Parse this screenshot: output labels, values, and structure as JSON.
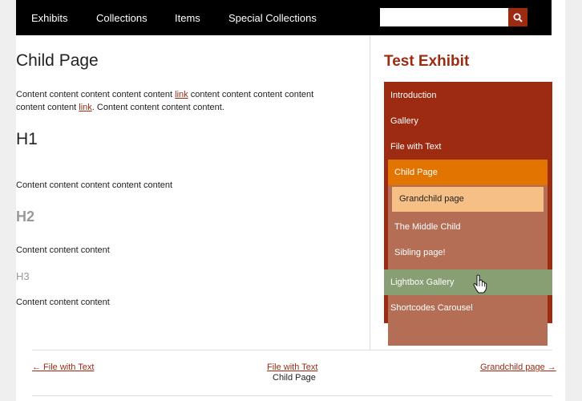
{
  "nav": {
    "items": [
      "Exhibits",
      "Collections",
      "Items",
      "Special Collections"
    ],
    "search_placeholder": ""
  },
  "main": {
    "title": "Child Page",
    "para1": {
      "text1": "Content content content content content ",
      "link1": "link",
      "text2": " content content content content",
      "text3": "content content ",
      "link2": "link",
      "text4": ". Content content content content."
    },
    "h1": "H1",
    "h1_content": "Content content content content content",
    "h2": "H2",
    "h2_content": "Content content content",
    "h3": "H3",
    "h3_content": "Content content content"
  },
  "sidebar": {
    "title": "Test Exhibit",
    "items": [
      "Introduction",
      "Gallery",
      "File with Text"
    ],
    "child_active": "Child Page",
    "grandchild": "Grandchild page",
    "sub_items": [
      "The Middle Child",
      "Sibling page!"
    ],
    "after_items": [
      "Lightbox Gallery",
      "Shortcodes Carousel"
    ]
  },
  "pager": {
    "prev": "← File with Text",
    "up": "File with Text",
    "current": "Child Page",
    "next": "Grandchild page →"
  },
  "colors": {
    "brand": "#9c2b12",
    "active": "#e27400",
    "grandchild": "#f6bf86",
    "sub_bg": "#b36e55",
    "hover": "#879f72"
  }
}
